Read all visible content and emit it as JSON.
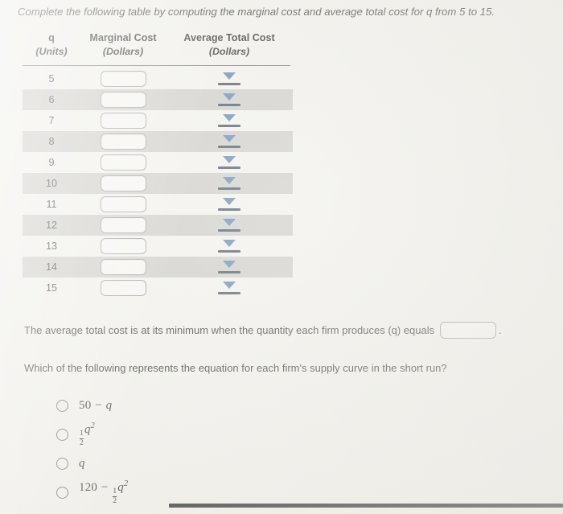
{
  "prompt": {
    "top_instruction": "Complete the following table by computing the marginal cost and average total cost for q from 5 to 15."
  },
  "table": {
    "headers": [
      {
        "title": "q",
        "sub": "(Units)"
      },
      {
        "title": "Marginal Cost",
        "sub": "(Dollars)"
      },
      {
        "title": "Average Total Cost",
        "sub": "(Dollars)"
      }
    ],
    "rows": [
      {
        "q": "5",
        "marginal_cost": "",
        "average_total_cost": ""
      },
      {
        "q": "6",
        "marginal_cost": "",
        "average_total_cost": ""
      },
      {
        "q": "7",
        "marginal_cost": "",
        "average_total_cost": ""
      },
      {
        "q": "8",
        "marginal_cost": "",
        "average_total_cost": ""
      },
      {
        "q": "9",
        "marginal_cost": "",
        "average_total_cost": ""
      },
      {
        "q": "10",
        "marginal_cost": "",
        "average_total_cost": ""
      },
      {
        "q": "11",
        "marginal_cost": "",
        "average_total_cost": ""
      },
      {
        "q": "12",
        "marginal_cost": "",
        "average_total_cost": ""
      },
      {
        "q": "13",
        "marginal_cost": "",
        "average_total_cost": ""
      },
      {
        "q": "14",
        "marginal_cost": "",
        "average_total_cost": ""
      },
      {
        "q": "15",
        "marginal_cost": "",
        "average_total_cost": ""
      }
    ]
  },
  "statement": {
    "text_before_blank": "The average total cost is at its minimum when the quantity each firm produces (q) equals",
    "blank_value": "",
    "text_after_blank": "."
  },
  "question": {
    "text": "Which of the following represents the equation for each firm's supply curve in the short run?"
  },
  "options": [
    {
      "id": "option-a",
      "label": "50 − q",
      "selected": false
    },
    {
      "id": "option-b",
      "label": "½q²",
      "selected": false
    },
    {
      "id": "option-c",
      "label": "q",
      "selected": false
    },
    {
      "id": "option-d",
      "label": "120 − ½q²",
      "selected": false
    }
  ],
  "colors": {
    "page_background": "#f2f1ec",
    "stripe": "#cbcac5",
    "caret_blue": "#5b82ab",
    "caret_bar": "#3e4d5c",
    "input_border": "#9a9a96",
    "rule": "#6e6e6e",
    "bottom_bar": "#1d1f22"
  }
}
